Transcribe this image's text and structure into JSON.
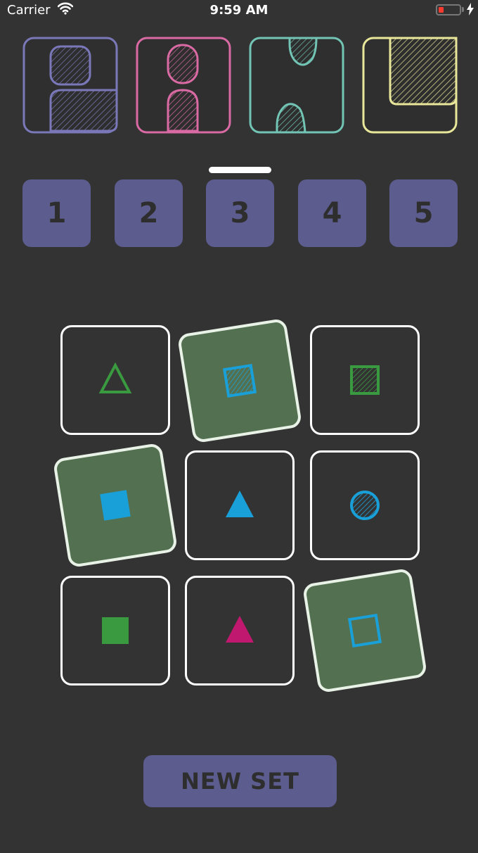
{
  "status_bar": {
    "carrier": "Carrier",
    "time": "9:59 AM",
    "battery_level": 0.1
  },
  "logo": {
    "letters": [
      "P",
      "A",
      "N",
      "L"
    ],
    "colors": [
      "#7a78b8",
      "#d96aa4",
      "#72c4b4",
      "#e9e79a"
    ]
  },
  "levels": {
    "items": [
      "1",
      "2",
      "3",
      "4",
      "5"
    ],
    "selected": "3"
  },
  "colors": {
    "background": "#333333",
    "accent": "#5c5c8e",
    "selected_card": "#537050",
    "green": "#3a9a3f",
    "blue": "#1aa0d8",
    "magenta": "#c0186e"
  },
  "grid": {
    "cards": [
      {
        "shape": "triangle",
        "fill": "outline",
        "color": "green",
        "selected": false
      },
      {
        "shape": "square",
        "fill": "striped",
        "color": "blue",
        "selected": true
      },
      {
        "shape": "square",
        "fill": "striped",
        "color": "green",
        "selected": false
      },
      {
        "shape": "square",
        "fill": "solid",
        "color": "blue",
        "selected": true
      },
      {
        "shape": "triangle",
        "fill": "solid",
        "color": "blue",
        "selected": false
      },
      {
        "shape": "circle",
        "fill": "striped",
        "color": "blue",
        "selected": false
      },
      {
        "shape": "square",
        "fill": "solid",
        "color": "green",
        "selected": false
      },
      {
        "shape": "triangle",
        "fill": "solid",
        "color": "magenta",
        "selected": false
      },
      {
        "shape": "square",
        "fill": "outline",
        "color": "blue",
        "selected": true
      }
    ]
  },
  "new_set_label": "NEW SET"
}
